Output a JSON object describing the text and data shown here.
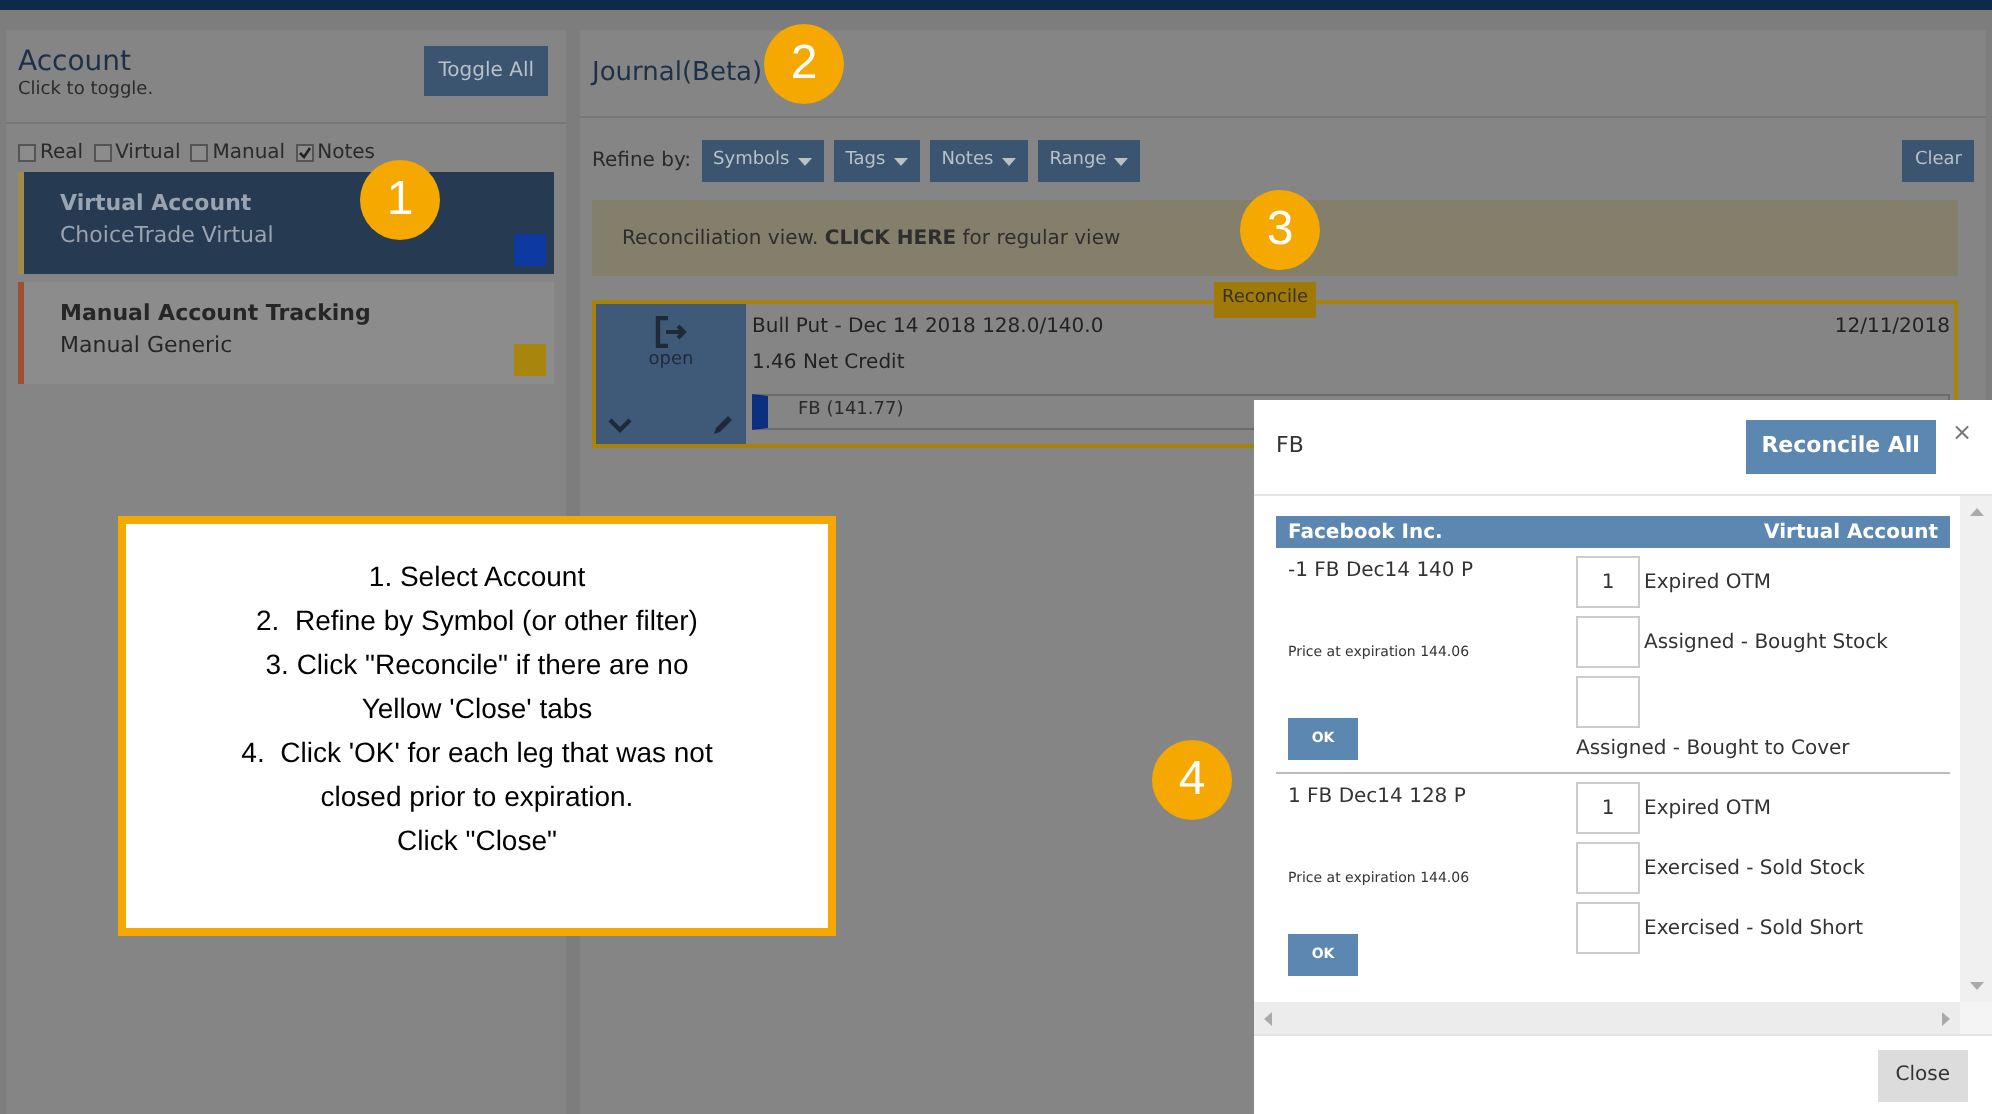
{
  "account_panel": {
    "title": "Account",
    "subtitle": "Click to toggle.",
    "toggle_button": "Toggle All",
    "filters": [
      {
        "label": "Real",
        "checked": false
      },
      {
        "label": "Virtual",
        "checked": false
      },
      {
        "label": "Manual",
        "checked": false
      },
      {
        "label": "Notes",
        "checked": true
      }
    ],
    "accounts": [
      {
        "name": "Virtual Account",
        "broker": "ChoiceTrade Virtual",
        "selected": true,
        "color": "#0c3aa0"
      },
      {
        "name": "Manual Account Tracking",
        "broker": "Manual Generic",
        "selected": false,
        "color": "#a8860e"
      }
    ]
  },
  "journal": {
    "title": "Journal(Beta)",
    "refine_label": "Refine by:",
    "filters": [
      "Symbols",
      "Tags",
      "Notes",
      "Range"
    ],
    "clear_button": "Clear",
    "banner": "Reconciliation view. **CLICK HERE** for regular view",
    "reconcile_tab": "Reconcile",
    "trade": {
      "status": "open",
      "title": "Bull Put - Dec 14 2018 128.0/140.0",
      "credit": "1.46 Net Credit",
      "date": "12/11/2018",
      "symbol": "FB (141.77)"
    }
  },
  "modal": {
    "title": "FB",
    "reconcile_all": "Reconcile All",
    "close_x": "×",
    "company": "Facebook Inc.",
    "account": "Virtual Account",
    "legs": [
      {
        "description": "-1 FB Dec14 140 P",
        "price": "Price at expiration 144.06",
        "ok": "OK",
        "options": [
          {
            "value": "1",
            "label": "Expired OTM",
            "kind": "inline"
          },
          {
            "label": "Assigned - Bought Stock",
            "kind": "inline"
          },
          {
            "label": "Assigned - Bought to Cover",
            "kind": "below"
          }
        ]
      },
      {
        "description": "1 FB Dec14 128 P",
        "price": "Price at expiration 144.06",
        "ok": "OK",
        "options": [
          {
            "value": "1",
            "label": "Expired OTM",
            "kind": "inline"
          },
          {
            "label": "Exercised - Sold Stock",
            "kind": "inline"
          },
          {
            "label": "Exercised - Sold Short",
            "kind": "inline"
          }
        ]
      }
    ],
    "close_button": "Close"
  },
  "callout": [
    "1. Select Account",
    "2.  Refine by Symbol (or other filter)",
    "3. Click \"Reconcile\" if there are no",
    "Yellow 'Close' tabs",
    "4.  Click 'OK' for each leg that was not",
    "closed prior to expiration.",
    "Click \"Close\""
  ],
  "badges": [
    "1",
    "2",
    "3",
    "4"
  ]
}
